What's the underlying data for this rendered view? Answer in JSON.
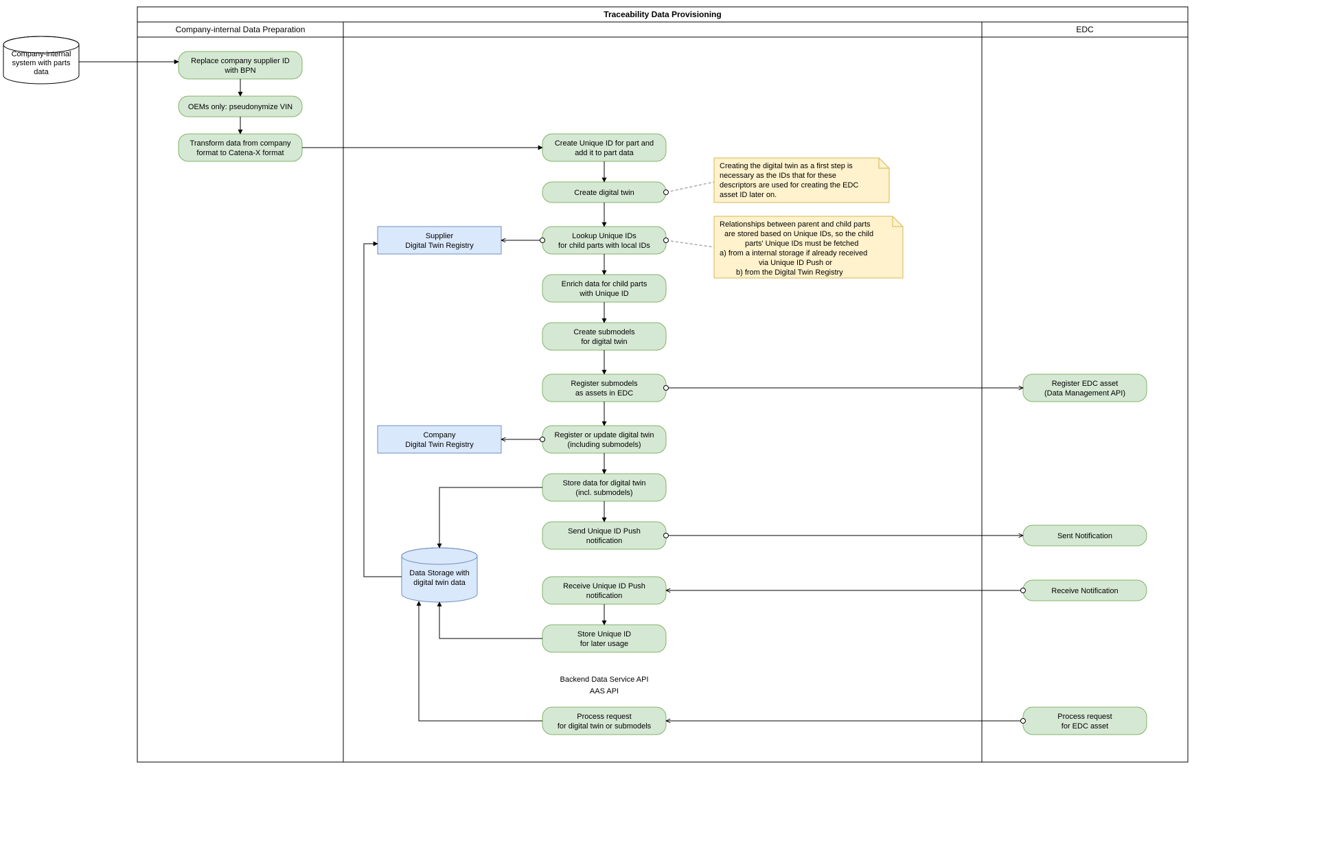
{
  "pool_title": "Traceability Data Provisioning",
  "lanes": {
    "prep": "Company-internal Data Preparation",
    "edc": "EDC"
  },
  "ext_cylinder": {
    "l1": "Company-internal",
    "l2": "system with parts",
    "l3": "data"
  },
  "prep_nodes": {
    "replace": {
      "l1": "Replace company supplier ID",
      "l2": "with BPN"
    },
    "oem": {
      "l1": "OEMs only: pseudonymize VIN"
    },
    "transform": {
      "l1": "Transform data from company",
      "l2": "format to Catena-X format"
    }
  },
  "main_nodes": {
    "create_uid": {
      "l1": "Create Unique ID for part and",
      "l2": "add it to part data"
    },
    "create_dt": {
      "l1": "Create digital twin"
    },
    "lookup": {
      "l1": "Lookup Unique IDs",
      "l2": "for child parts with local IDs"
    },
    "enrich": {
      "l1": "Enrich data for child parts",
      "l2": "with Unique ID"
    },
    "create_sub": {
      "l1": "Create submodels",
      "l2": "for digital twin"
    },
    "reg_sub": {
      "l1": "Register submodels",
      "l2": "as assets in EDC"
    },
    "reg_dt": {
      "l1": "Register or update digital twin",
      "l2": "(including submodels)"
    },
    "store_dt": {
      "l1": "Store data for digital twin",
      "l2": "(incl. submodels)"
    },
    "send_push": {
      "l1": "Send Unique ID Push",
      "l2": "notification"
    },
    "recv_push": {
      "l1": "Receive Unique ID Push",
      "l2": "notification"
    },
    "store_uid": {
      "l1": "Store Unique ID",
      "l2": "for later usage"
    },
    "process_req": {
      "l1": "Process request",
      "l2": "for digital twin or submodels"
    }
  },
  "blue_nodes": {
    "supplier_dtr": {
      "l1": "Supplier",
      "l2": "Digital Twin Registry"
    },
    "company_dtr": {
      "l1": "Company",
      "l2": "Digital Twin Registry"
    }
  },
  "edc_nodes": {
    "reg_asset": {
      "l1": "Register EDC asset",
      "l2": "(Data Management API)"
    },
    "sent_notif": {
      "l1": "Sent Notification"
    },
    "recv_notif": {
      "l1": "Receive Notification"
    },
    "proc_asset": {
      "l1": "Process request",
      "l2": "for EDC asset"
    }
  },
  "notes": {
    "n1": {
      "l1": "Creating the digital twin as a first step is",
      "l2": "necessary as the IDs that for these",
      "l3": "descriptors are used for creating the EDC",
      "l4": "asset ID later on."
    },
    "n2": {
      "l1": "Relationships between parent and child parts",
      "l2": "are stored based on Unique IDs, so the child",
      "l3": "parts' Unique IDs must be fetched",
      "l4": "a) from a internal storage if already received",
      "l5": "via Unique ID Push or",
      "l6": "b) from the Digital Twin Registry"
    }
  },
  "api_labels": {
    "l1": "Backend Data Service API",
    "l2": "AAS API"
  },
  "storage_cyl": {
    "l1": "Data Storage with",
    "l2": "digital twin data"
  }
}
